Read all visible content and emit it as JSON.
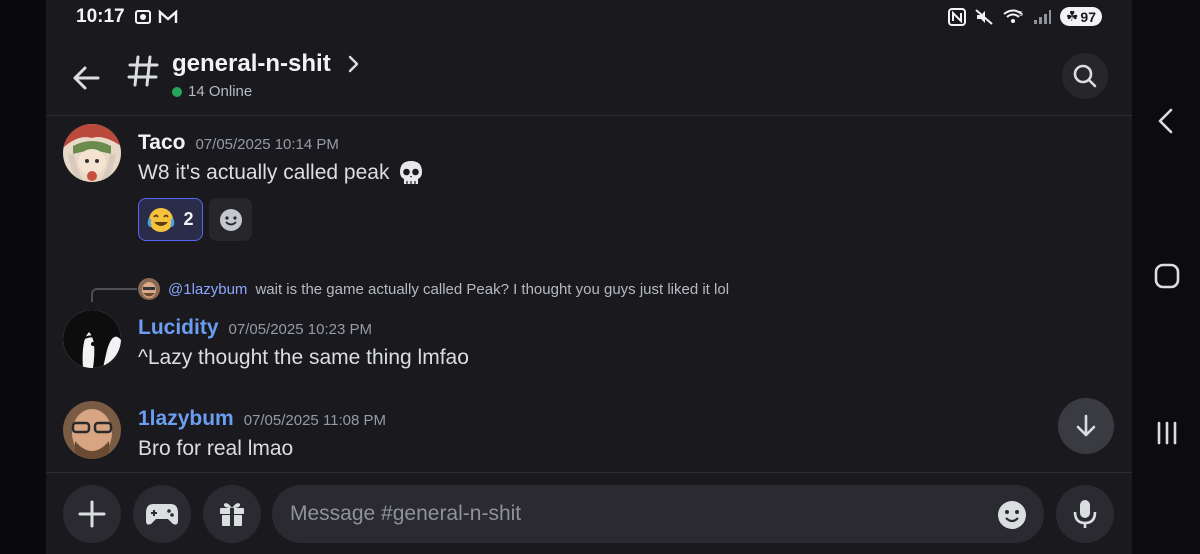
{
  "status_bar": {
    "time": "10:17",
    "battery": "97",
    "signal_label": "5"
  },
  "header": {
    "channel_name": "general-n-shit",
    "online": "14 Online"
  },
  "messages": [
    {
      "author": "Taco",
      "author_color": "#f2f3f5",
      "timestamp": "07/05/2025 10:14 PM",
      "text": "W8 it's actually called peak",
      "emoji": "skull",
      "reactions": [
        {
          "emoji": "joy",
          "count": "2"
        }
      ]
    },
    {
      "author": "Lucidity",
      "author_color": "#6b9df2",
      "timestamp": "07/05/2025 10:23 PM",
      "text": "^Lazy thought the same thing lmfao",
      "reply": {
        "mention": "@1lazybum",
        "text": "wait is the game actually called Peak? I thought you guys just liked it lol"
      }
    },
    {
      "author": "1lazybum",
      "author_color": "#6b9df2",
      "timestamp": "07/05/2025 11:08 PM",
      "text": "Bro for real lmao"
    }
  ],
  "composer": {
    "placeholder": "Message #general-n-shit"
  },
  "icons": {
    "back": "arrow-left-icon",
    "hash": "hash-icon",
    "search": "search-icon",
    "skull": "skull-icon",
    "add_reaction": "smile-icon",
    "scroll_down": "arrow-down-icon",
    "plus": "plus-icon",
    "games": "gamepad-icon",
    "gift": "gift-icon",
    "emoji": "emoji-icon",
    "mic": "mic-icon",
    "nav_back": "nav-back-icon",
    "nav_home": "nav-home-icon",
    "nav_recents": "nav-recents-icon"
  }
}
